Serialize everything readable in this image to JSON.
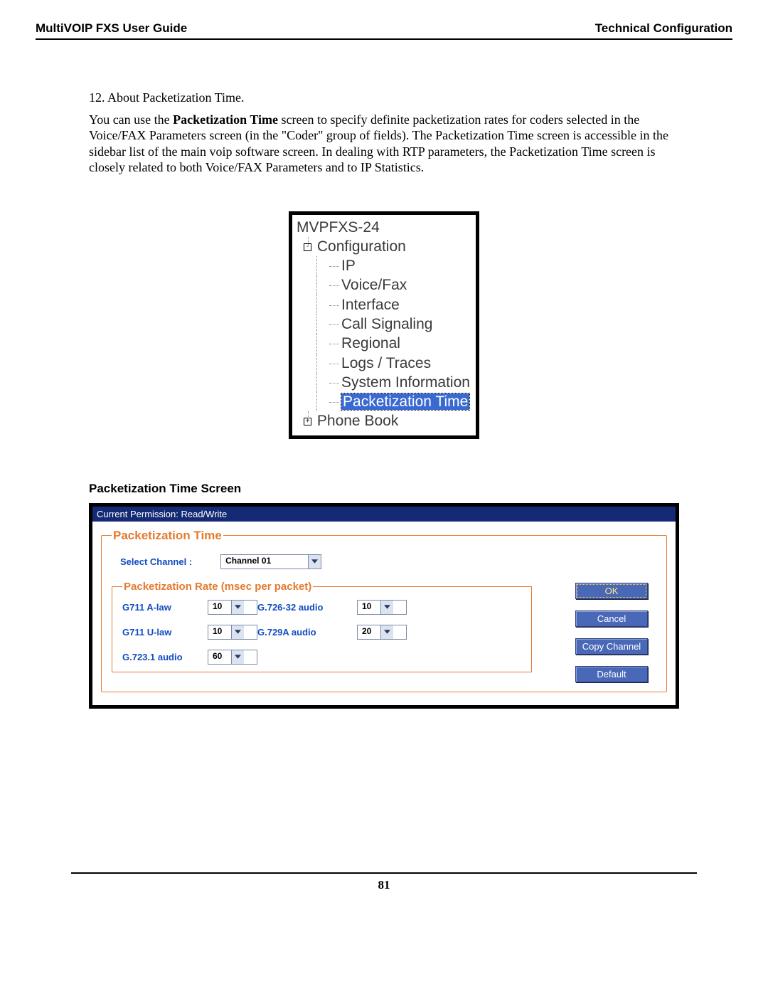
{
  "header": {
    "left": "MultiVOIP FXS User Guide",
    "right": "Technical Configuration"
  },
  "body": {
    "item_num": "12. ",
    "item_title": "About Packetization Time.",
    "para_pre": "You can use the ",
    "para_bold": "Packetization Time",
    "para_post": " screen to specify definite packetization rates for coders selected in the Voice/FAX Parameters screen (in the \"Coder\" group of fields).  The Packetization Time screen is accessible in the sidebar list of the main voip software screen.  In dealing with RTP parameters, the Packetization Time screen is closely related to both Voice/FAX Parameters and to IP Statistics."
  },
  "tree": {
    "root": "MVPFXS-24",
    "config": "Configuration",
    "items": [
      "IP",
      "Voice/Fax",
      "Interface",
      "Call Signaling",
      "Regional",
      "Logs / Traces",
      "System Information"
    ],
    "selected": "Packetization Time",
    "phonebook": "Phone Book"
  },
  "section_heading": "Packetization Time Screen",
  "dialog": {
    "permission": "Current Permission:  Read/Write",
    "legend_main": "Packetization Time",
    "select_channel_label": "Select Channel  :",
    "select_channel_value": "Channel 01",
    "legend_rate": "Packetization Rate (msec per packet)",
    "rows": [
      {
        "l1": "G711 A-law",
        "v1": "10",
        "l2": "G.726-32 audio",
        "v2": "10"
      },
      {
        "l1": "G711 U-law",
        "v1": "10",
        "l2": "G.729A audio",
        "v2": "20"
      },
      {
        "l1": "G.723.1 audio",
        "v1": "60",
        "l2": "",
        "v2": ""
      }
    ],
    "buttons": {
      "ok": "OK",
      "cancel": "Cancel",
      "copy": "Copy Channel",
      "default": "Default"
    }
  },
  "page_number": "81"
}
